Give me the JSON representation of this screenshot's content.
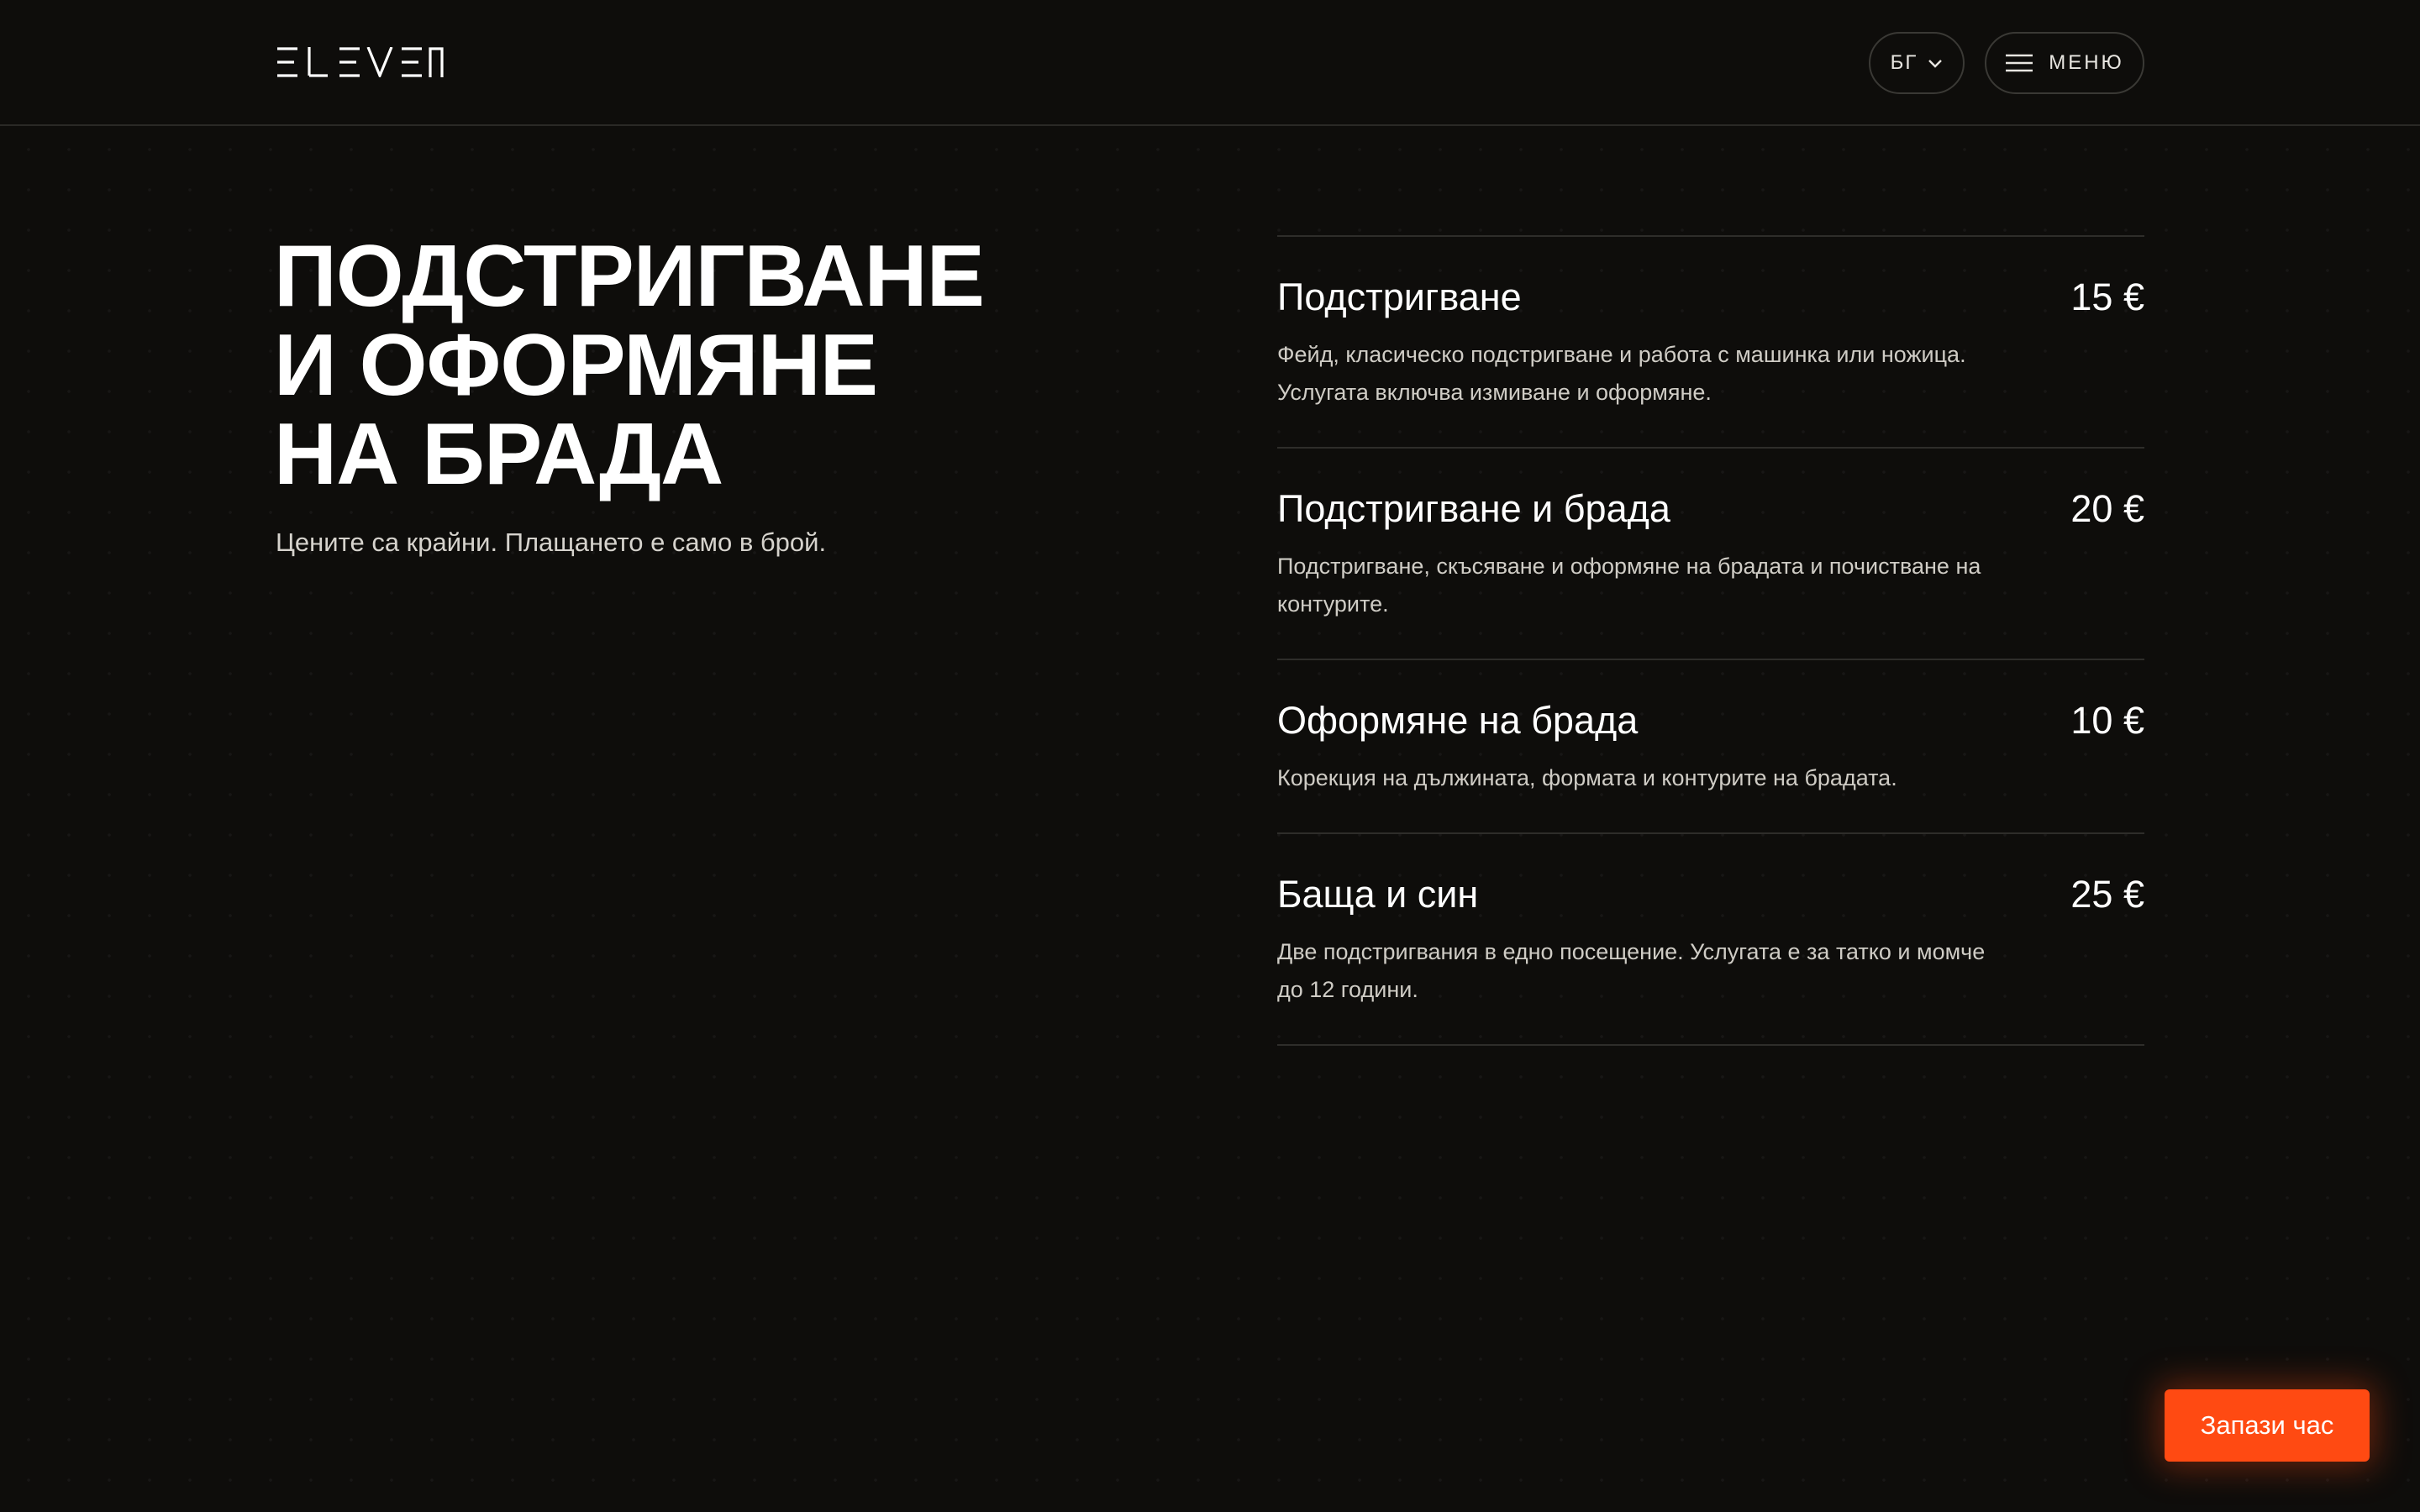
{
  "header": {
    "logo": "ELEVEN",
    "language_label": "БГ",
    "menu_label": "МЕНЮ"
  },
  "hero": {
    "title_lines": [
      "ПОДСТРИГВАНЕ",
      "И ОФОРМЯНЕ",
      "НА БРАДА"
    ],
    "subtitle": "Цените са крайни. Плащането е само в брой."
  },
  "services": [
    {
      "name": "Подстригване",
      "price": "15 €",
      "description": "Фейд, класическо подстригване и работа с машинка или ножица. Услугата включва измиване и оформяне."
    },
    {
      "name": "Подстригване и брада",
      "price": "20 €",
      "description": "Подстригване, скъсяване и оформяне на брадата и почистване на контурите."
    },
    {
      "name": "Оформяне на брада",
      "price": "10 €",
      "description": "Корекция на дължината, формата и контурите на брадата."
    },
    {
      "name": "Баща и син",
      "price": "25 €",
      "description": "Две подстригвания в едно посещение. Услугата е за татко и момче до 12 години."
    }
  ],
  "cta": {
    "book_label": "Запази час"
  },
  "colors": {
    "background": "#0e0d0b",
    "accent": "#ff4a12",
    "divider": "#2e2d2a"
  },
  "icons": {
    "language_chevron": "chevron-down-icon",
    "menu": "hamburger-icon"
  }
}
